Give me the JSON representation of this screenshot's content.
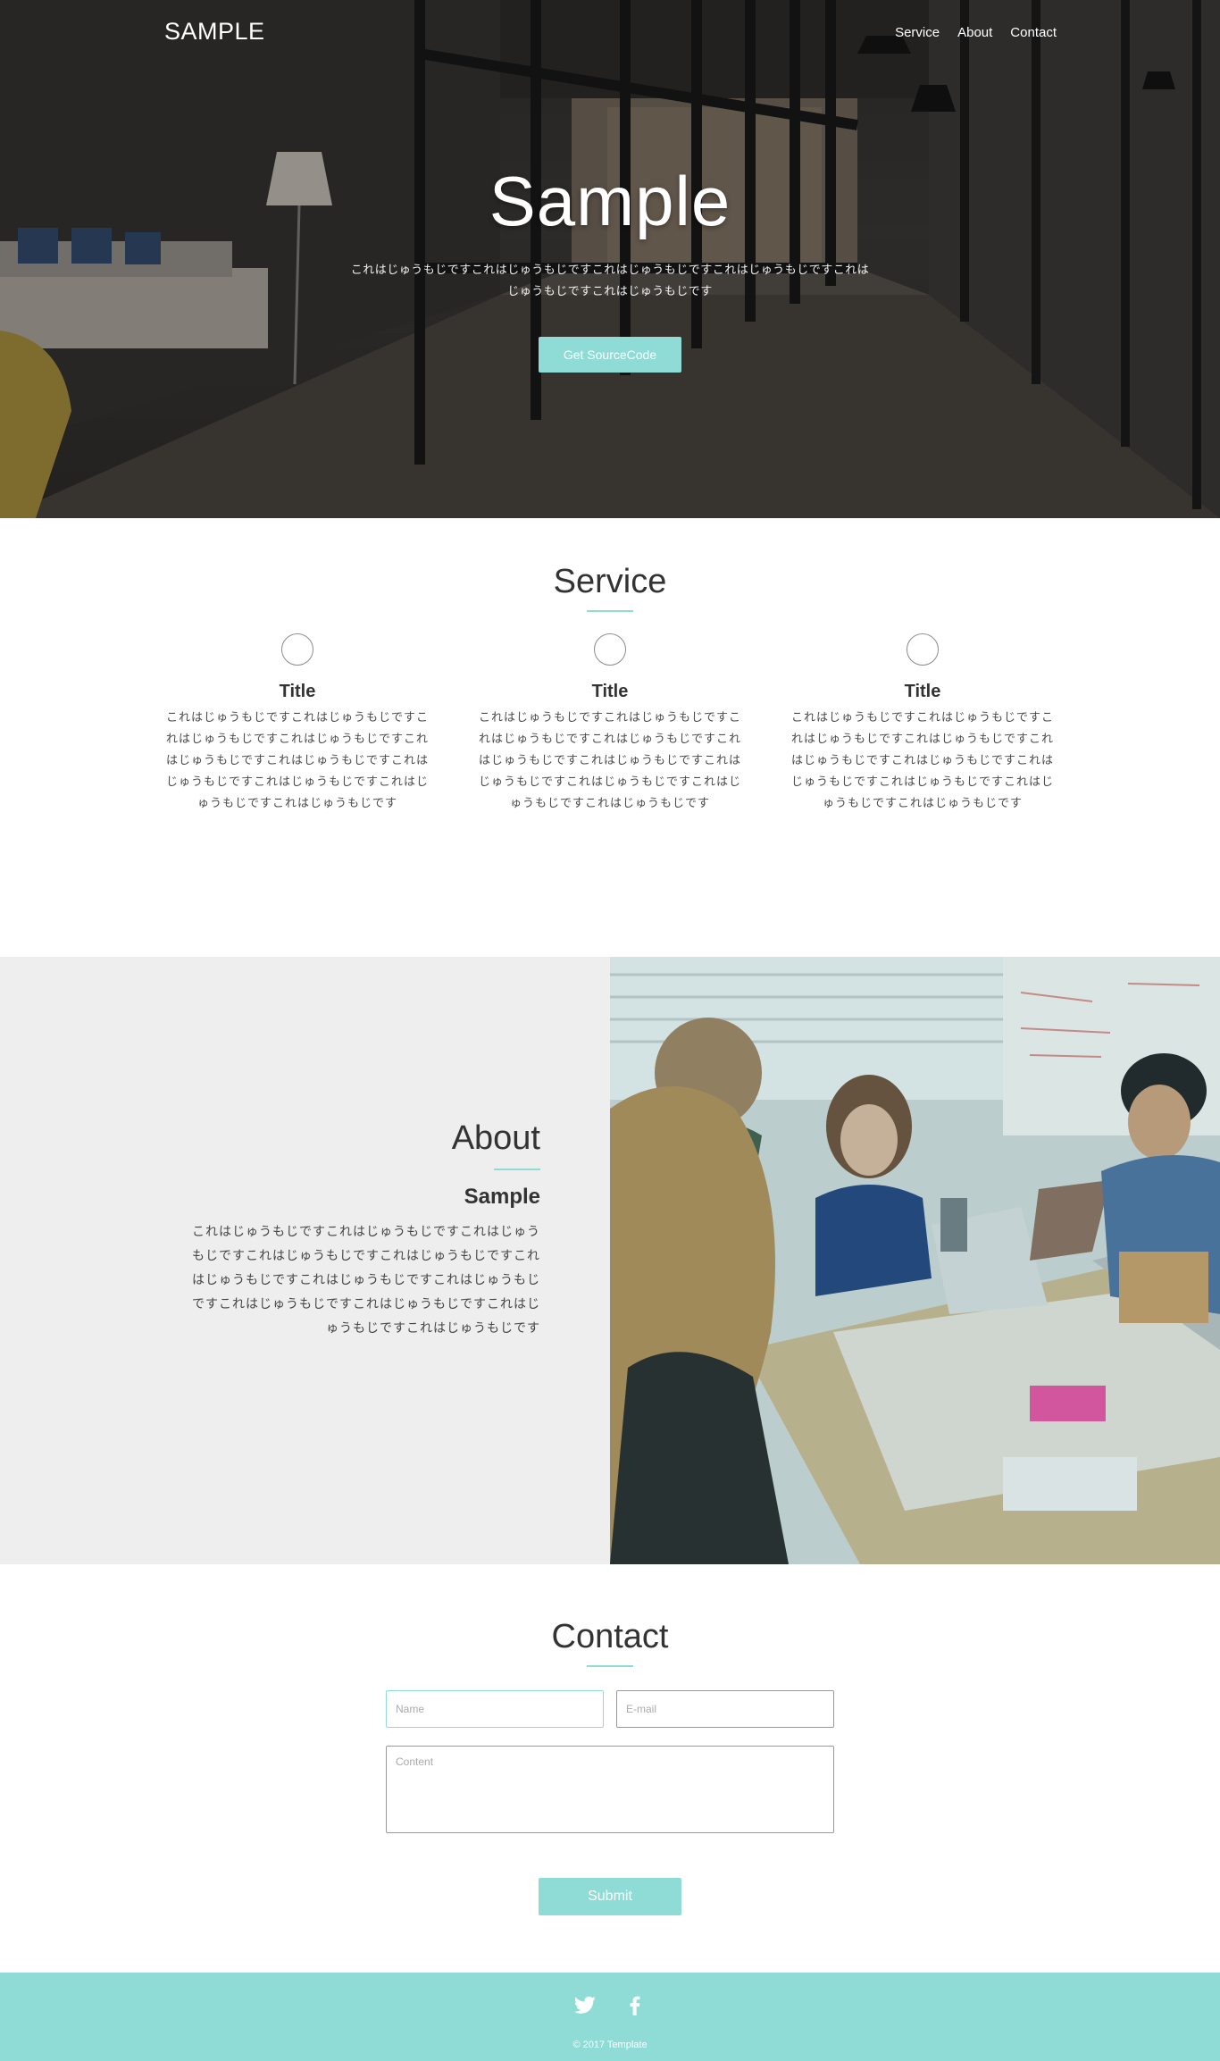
{
  "header": {
    "logo": "SAMPLE",
    "nav": [
      "Service",
      "About",
      "Contact"
    ]
  },
  "hero": {
    "title": "Sample",
    "text": "これはじゅうもじですこれはじゅうもじですこれはじゅうもじですこれはじゅうもじですこれはじゅうもじですこれはじゅうもじです",
    "button": "Get SourceCode"
  },
  "service": {
    "title": "Service",
    "items": [
      {
        "icon": "circle-icon",
        "title": "Title",
        "text": "これはじゅうもじですこれはじゅうもじですこれはじゅうもじですこれはじゅうもじですこれはじゅうもじですこれはじゅうもじですこれはじゅうもじですこれはじゅうもじですこれはじゅうもじですこれはじゅうもじです"
      },
      {
        "icon": "circle-icon",
        "title": "Title",
        "text": "これはじゅうもじですこれはじゅうもじですこれはじゅうもじですこれはじゅうもじですこれはじゅうもじですこれはじゅうもじですこれはじゅうもじですこれはじゅうもじですこれはじゅうもじですこれはじゅうもじです"
      },
      {
        "icon": "circle-icon",
        "title": "Title",
        "text": "これはじゅうもじですこれはじゅうもじですこれはじゅうもじですこれはじゅうもじですこれはじゅうもじですこれはじゅうもじですこれはじゅうもじですこれはじゅうもじですこれはじゅうもじですこれはじゅうもじです"
      }
    ]
  },
  "about": {
    "title": "About",
    "subtitle": "Sample",
    "text": "これはじゅうもじですこれはじゅうもじですこれはじゅうもじですこれはじゅうもじですこれはじゅうもじですこれはじゅうもじですこれはじゅうもじですこれはじゅうもじですこれはじゅうもじですこれはじゅうもじですこれはじゅうもじですこれはじゅうもじです"
  },
  "contact": {
    "title": "Contact",
    "name_placeholder": "Name",
    "email_placeholder": "E-mail",
    "content_placeholder": "Content",
    "submit": "Submit"
  },
  "footer": {
    "icons": [
      "twitter-icon",
      "facebook-icon"
    ],
    "copyright": "© 2017  Template"
  },
  "colors": {
    "accent": "#8fdcd6",
    "about_bg": "#eeeeee",
    "text": "#333333"
  }
}
